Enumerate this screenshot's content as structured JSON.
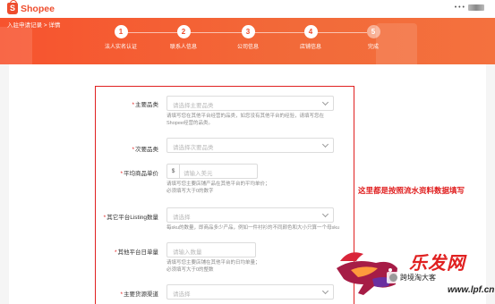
{
  "app": {
    "logo_text": "Shopee",
    "logo_glyph": "S"
  },
  "header": {
    "user_text": "• • •"
  },
  "breadcrumb": "入驻申请记录 > 详情",
  "steps": [
    {
      "num": "1",
      "label": "法人实名认证",
      "state": "done"
    },
    {
      "num": "2",
      "label": "联系人信息",
      "state": "done"
    },
    {
      "num": "3",
      "label": "公司信息",
      "state": "done"
    },
    {
      "num": "4",
      "label": "店铺信息",
      "state": "current"
    },
    {
      "num": "5",
      "label": "完成",
      "state": "pending"
    }
  ],
  "form": {
    "main_category": {
      "label": "主要品类",
      "placeholder": "请选择主要品类",
      "help": [
        "请填写您在其他平台经营的品类，如您没有其他平台的经验，请填写您在",
        "Shopee经营的品类。"
      ]
    },
    "sub_category": {
      "label": "次要品类",
      "placeholder": "请选择次要品类"
    },
    "avg_price": {
      "label": "平均商品单价",
      "prefix": "$",
      "placeholder": "请输入美元",
      "help": [
        "请填写您主要店铺产品在其他平台的平均单价；",
        "必须填写大于0的数字"
      ]
    },
    "listing_count": {
      "label": "其它平台Listing数量",
      "placeholder": "请选择",
      "help": [
        "每sku的数量，即商品多少产品，例如一件衬衫的不同颜色和大小只算一个母sku"
      ]
    },
    "daily_orders": {
      "label": "其他平台日单量",
      "placeholder": "请输入数量",
      "help": [
        "请填写您主要店铺在其他平台的日均单量；",
        "必须填写大于0的整数"
      ]
    },
    "main_channel": {
      "label": "主要货源渠道",
      "placeholder": "请选择"
    }
  },
  "annotation": "这里都是按照流水资料数据填写",
  "watermark": {
    "brand": "乐发网",
    "account": "跨境淘大客",
    "url": "www.lpf.cn"
  },
  "colors": {
    "brand": "#ee4d2d",
    "highlight_red": "#e02020"
  }
}
